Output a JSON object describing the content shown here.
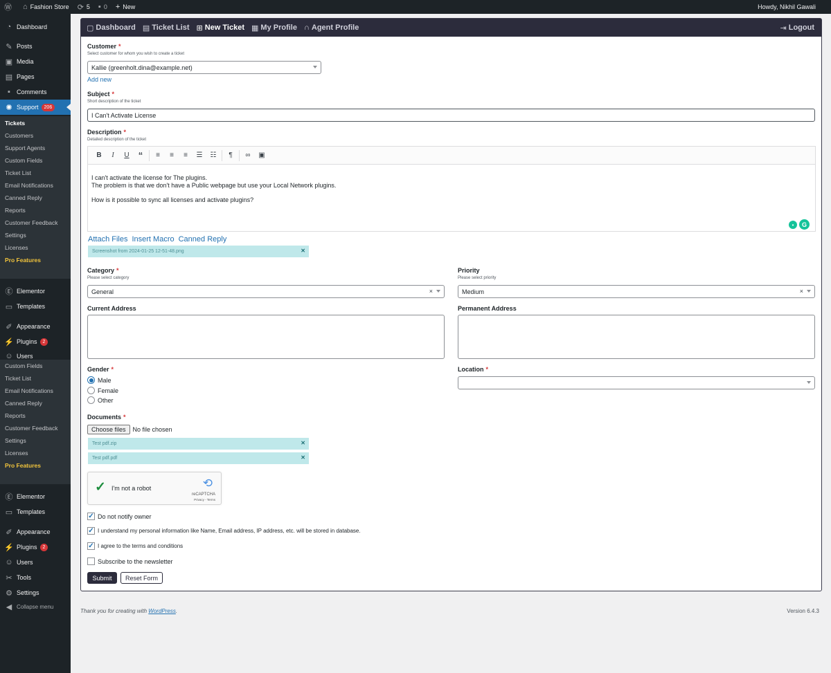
{
  "adminbar": {
    "wp_icon": "wordpress-icon",
    "site_name": "Fashion Store",
    "updates_count": "5",
    "comments_count": "0",
    "new_label": "New",
    "howdy": "Howdy, Nikhil Gawali"
  },
  "sidebar": {
    "dashboard": "Dashboard",
    "posts": "Posts",
    "media": "Media",
    "pages": "Pages",
    "comments": "Comments",
    "support": "Support",
    "support_badge": "206",
    "support_sub": {
      "tickets": "Tickets",
      "customers": "Customers",
      "support_agents": "Support Agents",
      "custom_fields": "Custom Fields",
      "ticket_list": "Ticket List",
      "email_notifications": "Email Notifications",
      "canned_reply": "Canned Reply",
      "reports": "Reports",
      "customer_feedback": "Customer Feedback",
      "settings": "Settings",
      "licenses": "Licenses",
      "pro_features": "Pro Features"
    },
    "elementor": "Elementor",
    "templates": "Templates",
    "appearance": "Appearance",
    "plugins": "Plugins",
    "plugins_badge": "2",
    "users": "Users",
    "tools": "Tools",
    "settings": "Settings",
    "collapse": "Collapse menu",
    "dup_sub": {
      "custom_fields": "Custom Fields",
      "ticket_list": "Ticket List",
      "email_notifications": "Email Notifications",
      "canned_reply": "Canned Reply",
      "reports": "Reports",
      "customer_feedback": "Customer Feedback",
      "settings": "Settings",
      "licenses": "Licenses",
      "pro_features": "Pro Features"
    }
  },
  "topnav": {
    "dashboard": "Dashboard",
    "ticket_list": "Ticket List",
    "new_ticket": "New Ticket",
    "my_profile": "My Profile",
    "agent_profile": "Agent Profile",
    "logout": "Logout"
  },
  "form": {
    "customer": {
      "label": "Customer",
      "hint": "Select customer for whom you wish to create a ticket",
      "value": "Kallie (greenholt.dina@example.net)",
      "add_new": "Add new"
    },
    "subject": {
      "label": "Subject",
      "hint": "Short description of the ticket",
      "value": "I Can't Activate License"
    },
    "description": {
      "label": "Description",
      "hint": "Detailed description of the ticket",
      "line1": "I can't activate the license for The plugins.",
      "line2": "The problem is that we don't have a Public webpage but use your Local Network plugins.",
      "line3": "How is it possible to sync all licenses and activate plugins?"
    },
    "actions": {
      "attach_files": "Attach Files",
      "insert_macro": "Insert Macro",
      "canned_reply": "Canned Reply"
    },
    "attachment": "Screenshot from 2024-01-25 12-51-48.png",
    "category": {
      "label": "Category",
      "hint": "Please select category",
      "value": "General"
    },
    "priority": {
      "label": "Priority",
      "hint": "Please select priority",
      "value": "Medium"
    },
    "current_address": {
      "label": "Current Address"
    },
    "permanent_address": {
      "label": "Permanent Address"
    },
    "gender": {
      "label": "Gender",
      "options": [
        "Male",
        "Female",
        "Other"
      ],
      "selected": "Male"
    },
    "location": {
      "label": "Location",
      "value": ""
    },
    "documents": {
      "label": "Documents",
      "choose_button": "Choose files",
      "no_file": "No file chosen",
      "files": [
        "Test pdf.zip",
        "Test pdf.pdf"
      ]
    },
    "captcha": {
      "label": "I'm not a robot",
      "brand": "reCAPTCHA",
      "links": "Privacy - Terms"
    },
    "checkboxes": {
      "notify": "Do not notify owner",
      "privacy": "I understand my personal information like Name, Email address, IP address, etc. will be stored in database.",
      "terms": "I agree to the terms and conditions",
      "newsletter": "Subscribe to the newsletter"
    },
    "submit": "Submit",
    "reset": "Reset Form"
  },
  "footer": {
    "thanks_prefix": "Thank you for creating with ",
    "wordpress_link": "WordPress",
    "thanks_suffix": ".",
    "version": "Version 6.4.3"
  },
  "colors": {
    "admin_bar": "#1d2327",
    "accent": "#2271b1",
    "nav_bg": "#2c2c3c",
    "file_chip": "#bfe8ea",
    "required": "#d63638"
  }
}
